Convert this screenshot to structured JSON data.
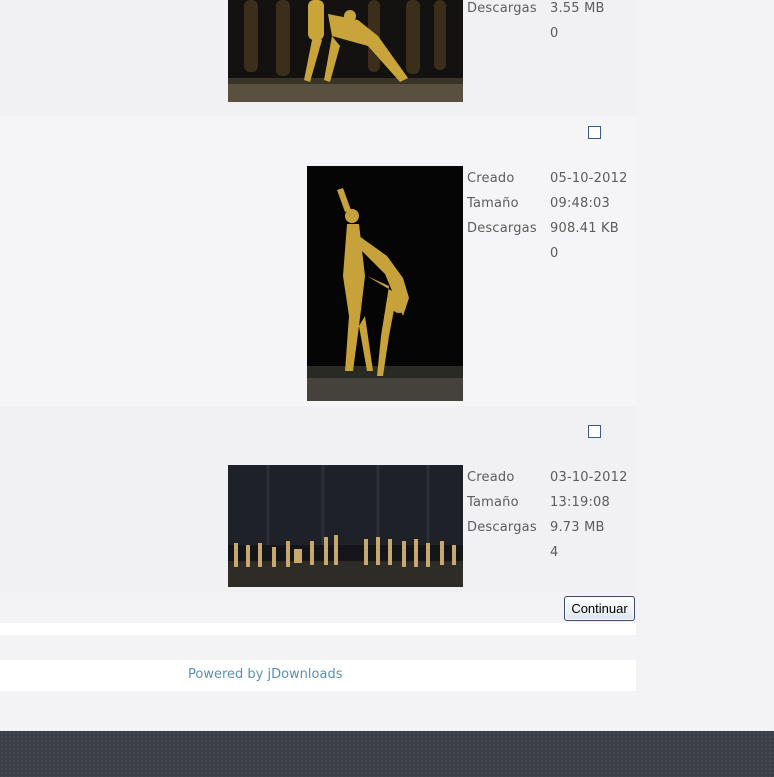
{
  "items": [
    {
      "labels": [
        "Descargas"
      ],
      "values": [
        "3.55 MB",
        "0"
      ]
    },
    {
      "labels": [
        "Creado",
        "Tamaño",
        "Descargas"
      ],
      "values": [
        "05-10-2012",
        "09:48:03",
        "908.41 KB",
        "0"
      ]
    },
    {
      "labels": [
        "Creado",
        "Tamaño",
        "Descargas"
      ],
      "values": [
        "03-10-2012",
        "13:19:08",
        "9.73 MB",
        "4"
      ]
    }
  ],
  "continue_button": "Continuar",
  "footer_link": "Powered by jDownloads",
  "colors": {
    "page_bg": "#f3f3f5",
    "link": "#5a8fb8",
    "checkbox_border": "#3a5a8a",
    "footer_bg": "#3d3f46"
  }
}
